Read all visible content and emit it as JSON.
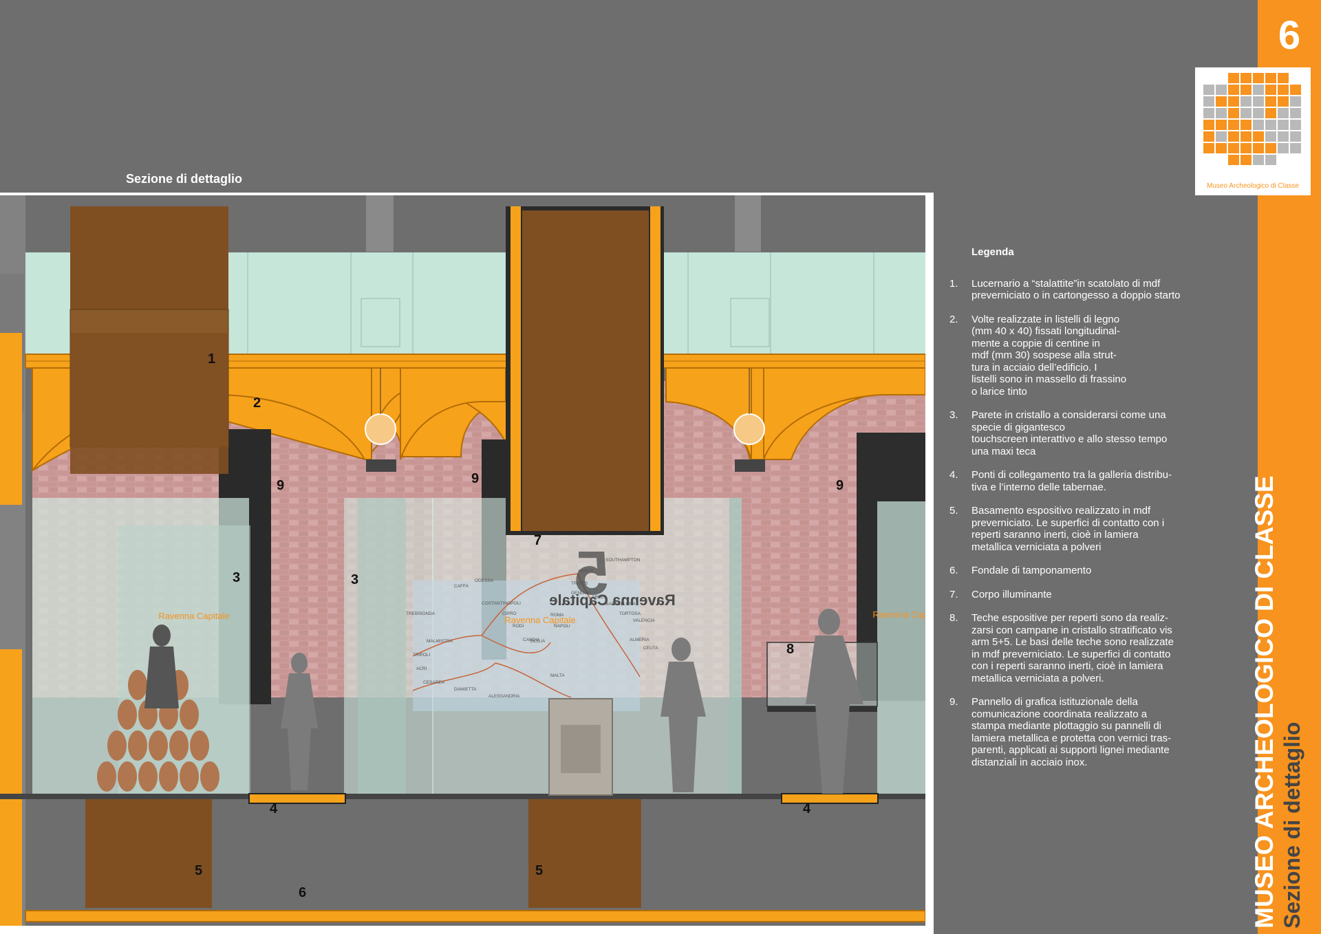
{
  "section_title": "Sezione di dettaglio",
  "page_number": "6",
  "logo": {
    "caption": "Museo Archeologico di Classe"
  },
  "vertical_title": {
    "main": "MUSEO ARCHEOLOGICO DI CLASSE",
    "sub": "Sezione di dettaglio"
  },
  "legend": {
    "title": "Legenda",
    "items": [
      {
        "num": "1.",
        "text": "Lucernario a “stalattite”in scatolato di mdf\npreverniciato o in cartongesso a doppio starto"
      },
      {
        "num": "2.",
        "text": "Volte realizzate in listelli di legno\n(mm 40 x 40) fissati longitudinal-\nmente a coppie di centine in\nmdf (mm 30) sospese alla strut-\ntura in acciaio dell’edificio. I\nlistelli sono in massello di frassino\no larice tinto"
      },
      {
        "num": "3.",
        "text": "Parete  in cristallo a considerarsi come una\nspecie di gigantesco\ntouchscreen interattivo e allo stesso tempo\nuna maxi teca"
      },
      {
        "num": "4.",
        "text": "Ponti di collegamento tra la galleria distribu-\ntiva e l’interno delle tabernae."
      },
      {
        "num": "5.",
        "text": "Basamento espositivo realizzato in mdf\npreverniciato. Le superfici di contatto con i\nreperti saranno inerti, cioè in lamiera\nmetallica verniciata a polveri"
      },
      {
        "num": "6.",
        "text": "Fondale di tamponamento"
      },
      {
        "num": "7.",
        "text": "Corpo illuminante"
      },
      {
        "num": "8.",
        "text": "Teche espositive per reperti sono da realiz-\nzarsi con campane in cristallo stratificato vis\narm 5+5. Le basi delle teche sono realizzate\nin mdf preverniciato. Le superfici di contatto\ncon i reperti saranno inerti, cioè in lamiera\nmetallica verniciata a polveri."
      },
      {
        "num": "9.",
        "text": "Pannello di grafica istituzionale della\ncomunicazione coordinata realizzato a\nstampa mediante plottaggio su pannelli di\nlamiera metallica e protetta con vernici tras-\nparenti, applicati ai supporti lignei mediante\ndistanziali in acciaio inox."
      }
    ]
  },
  "drawing": {
    "panel_title": "Ravenna Capitale",
    "panel_title_mirrored": "Ravenna Capitale",
    "panel_number": "5",
    "labels": {
      "n1": "1",
      "n2": "2",
      "n3": "3",
      "n4": "4",
      "n5": "5",
      "n6": "6",
      "n7": "7",
      "n8": "8",
      "n9": "9"
    },
    "map_places": [
      "ARRAS",
      "SOUTHAMPTON",
      "TROIES",
      "GENOVA",
      "ARLES",
      "BARCELLONA",
      "TORTOSA",
      "VALENCIA",
      "ALMERIA",
      "CEUTA",
      "ODESSA",
      "CAFFA",
      "COSTANTINOPOLI",
      "TREBISONDA",
      "CIPRO",
      "RODI",
      "MALMISTRA",
      "CANDIA",
      "TRIPOLI",
      "ACRI",
      "CESAREA",
      "DAMIETTA",
      "ALESSANDRIA",
      "MALTA",
      "ROMA",
      "NAPOLI",
      "SICILIA"
    ]
  },
  "colors": {
    "accent": "#f7931e",
    "background": "#6e6e6e",
    "wood": "#7f4f22",
    "glass": "#c6e6da"
  }
}
